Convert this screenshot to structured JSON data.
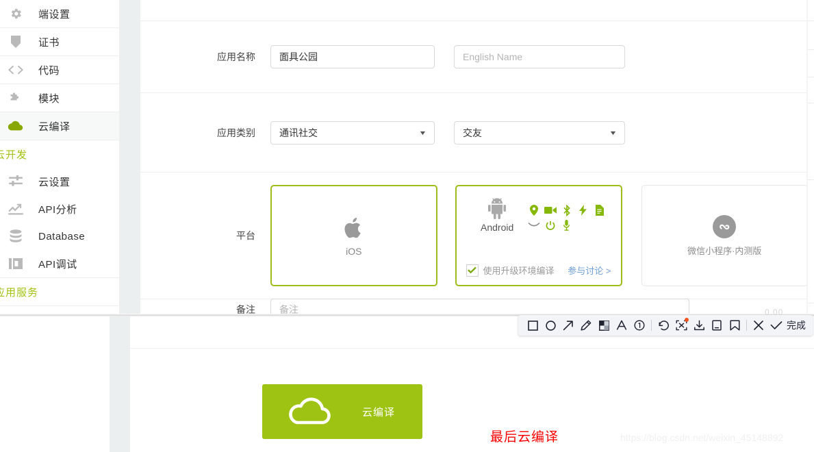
{
  "sidebar": {
    "items": [
      {
        "label": "端设置",
        "icon": "gear-icon",
        "active": false
      },
      {
        "label": "证书",
        "icon": "certificate-icon",
        "active": false
      },
      {
        "label": "代码",
        "icon": "code-icon",
        "active": false
      },
      {
        "label": "模块",
        "icon": "puzzle-icon",
        "active": false
      },
      {
        "label": "云编译",
        "icon": "cloud-icon",
        "active": true
      }
    ],
    "group_cloud": "云开发",
    "cloud_items": [
      {
        "label": "云设置",
        "icon": "sliders-icon"
      },
      {
        "label": "API分析",
        "icon": "chart-line-icon"
      },
      {
        "label": "Database",
        "icon": "database-icon"
      },
      {
        "label": "API调试",
        "icon": "api-debug-icon"
      }
    ],
    "group_service": "应用服务",
    "accent_color": "#a3c214"
  },
  "form": {
    "app_name": {
      "label": "应用名称",
      "value": "面具公园",
      "en_placeholder": "English Name",
      "en_value": ""
    },
    "app_category": {
      "label": "应用类别",
      "primary": "通讯社交",
      "secondary": "交友"
    },
    "platform": {
      "label": "平台",
      "cards": [
        {
          "name": "ios",
          "title": "iOS",
          "icon": "apple-icon",
          "selected": true
        },
        {
          "name": "android",
          "title": "Android",
          "icon": "android-icon",
          "selected": true,
          "permission_icons": [
            "location-icon",
            "video-camera-icon",
            "bluetooth-icon",
            "flash-icon",
            "document-icon",
            "chevron-down-icon",
            "power-icon",
            "microphone-icon"
          ],
          "checkbox": {
            "label": "使用升级环境编译",
            "checked": true
          },
          "link": "参与讨论 >"
        },
        {
          "name": "wechat-miniprogram",
          "title": "微信小程序·内测版",
          "icon": "wechat-miniprogram-icon",
          "selected": false
        }
      ]
    },
    "remark": {
      "label": "备注",
      "placeholder": "备注",
      "value": ""
    }
  },
  "cloud_button": {
    "label": "云编译",
    "icon": "cloud-outline-icon",
    "color": "#9ec313"
  },
  "annotation": {
    "red_note": "最后云编译",
    "red_color": "#fe0000"
  },
  "watermark": "https://blog.csdn.net/weixin_45148892",
  "ghost_number": "0.00",
  "toolbar": {
    "tools": [
      {
        "name": "rectangle-tool-icon",
        "title": "矩形"
      },
      {
        "name": "ellipse-tool-icon",
        "title": "椭圆"
      },
      {
        "name": "arrow-tool-icon",
        "title": "箭头"
      },
      {
        "name": "pen-tool-icon",
        "title": "画笔"
      },
      {
        "name": "mosaic-tool-icon",
        "title": "马赛克"
      },
      {
        "name": "text-tool-icon",
        "title": "文字"
      },
      {
        "name": "serial-number-tool-icon",
        "title": "序号"
      }
    ],
    "actions": [
      {
        "name": "undo-icon",
        "title": "撤销",
        "badge": false
      },
      {
        "name": "ocr-icon",
        "title": "文字识别",
        "badge": true
      },
      {
        "name": "download-icon",
        "title": "下载",
        "badge": false
      },
      {
        "name": "pin-icon",
        "title": "钉在桌面",
        "badge": false
      },
      {
        "name": "bookmark-icon",
        "title": "收藏",
        "badge": false
      }
    ],
    "close": {
      "name": "close-icon",
      "title": "取消"
    },
    "confirm": {
      "name": "check-icon",
      "title": "确认"
    },
    "done_label": "完成"
  }
}
